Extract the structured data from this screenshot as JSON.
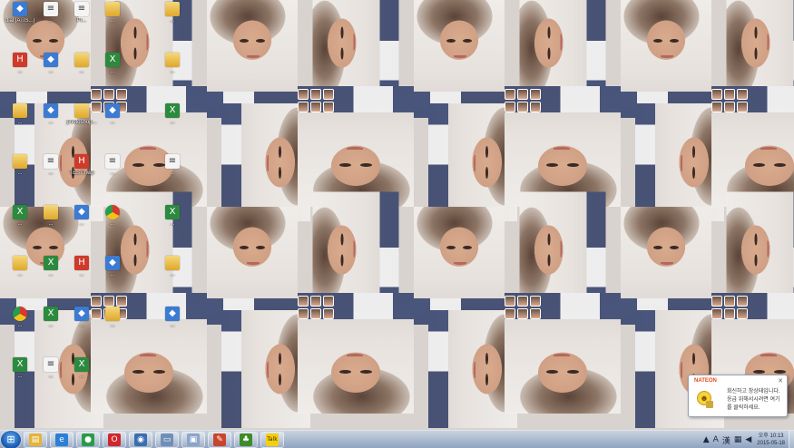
{
  "desktop": {
    "icons": [
      {
        "label": "dial [ATIS...]",
        "icon": "app-icon"
      },
      {
        "label": "...",
        "icon": "doc-icon"
      },
      {
        "label": "PI...",
        "icon": "doc-icon"
      },
      {
        "label": "...",
        "icon": "folder-icon"
      },
      {
        "label": "...",
        "icon": "folder-icon"
      },
      {
        "label": "...",
        "icon": "red-app-icon"
      },
      {
        "label": "...",
        "icon": "app-icon"
      },
      {
        "label": "...",
        "icon": "folder-icon"
      },
      {
        "label": "...",
        "icon": "excel-icon"
      },
      {
        "label": "...",
        "icon": "folder-icon"
      },
      {
        "label": "...",
        "icon": "folder-icon"
      },
      {
        "label": "...",
        "icon": "app-icon"
      },
      {
        "label": "photoshop...",
        "icon": "folder-icon"
      },
      {
        "label": "...",
        "icon": "app-icon"
      },
      {
        "label": "...",
        "icon": "excel-icon"
      },
      {
        "label": "...",
        "icon": "folder-icon"
      },
      {
        "label": "...",
        "icon": "doc-icon"
      },
      {
        "label": "TEST.hwp",
        "icon": "red-app-icon"
      },
      {
        "label": "...",
        "icon": "doc-icon"
      },
      {
        "label": "...",
        "icon": "doc-icon"
      },
      {
        "label": "...",
        "icon": "excel-icon"
      },
      {
        "label": "...",
        "icon": "folder-icon"
      },
      {
        "label": "...",
        "icon": "app-icon"
      },
      {
        "label": "...",
        "icon": "chrome-icon"
      },
      {
        "label": "...",
        "icon": "excel-icon"
      },
      {
        "label": "...",
        "icon": "folder-icon"
      },
      {
        "label": "...",
        "icon": "excel-icon"
      },
      {
        "label": "...",
        "icon": "red-app-icon"
      },
      {
        "label": "...",
        "icon": "app-icon"
      },
      {
        "label": "...",
        "icon": "folder-icon"
      },
      {
        "label": "...",
        "icon": "chrome-icon"
      },
      {
        "label": "...",
        "icon": "excel-icon"
      },
      {
        "label": "...",
        "icon": "app-icon"
      },
      {
        "label": "...",
        "icon": "folder-icon"
      },
      {
        "label": "...",
        "icon": "app-icon"
      },
      {
        "label": "...",
        "icon": "excel-icon"
      },
      {
        "label": "...",
        "icon": "doc-icon"
      },
      {
        "label": "...",
        "icon": "excel-icon"
      }
    ]
  },
  "taskbar": {
    "pinned": [
      {
        "name": "folder-explorer",
        "glyph": "▤",
        "color": "#e6b33a"
      },
      {
        "name": "internet-explorer",
        "glyph": "e",
        "color": "#2b7fd4"
      },
      {
        "name": "chrome",
        "glyph": "●",
        "color": "#2a9b4a"
      },
      {
        "name": "opera",
        "glyph": "O",
        "color": "#d0262b"
      },
      {
        "name": "media-app",
        "glyph": "◉",
        "color": "#3a6fb0"
      },
      {
        "name": "notepad",
        "glyph": "▭",
        "color": "#6f8fb6"
      },
      {
        "name": "window-app",
        "glyph": "▣",
        "color": "#8aa5c8"
      },
      {
        "name": "red-app",
        "glyph": "✎",
        "color": "#c9452e"
      },
      {
        "name": "green-app",
        "glyph": "♣",
        "color": "#3f8a2a"
      },
      {
        "name": "kakaotalk",
        "glyph": "Talk",
        "color": "#f3cf0d"
      }
    ],
    "tray": {
      "lang": "A",
      "hanja": "漢",
      "time": "오후 10:13",
      "date": "2015-05-18"
    }
  },
  "notification": {
    "brand": "NATEON",
    "close": "✕",
    "message": "회신하고 창상태입니다. 응급 위해서시려면 여기를 클릭하세요."
  }
}
